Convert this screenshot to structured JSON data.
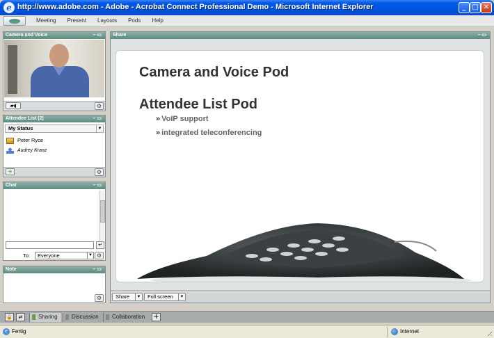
{
  "window": {
    "title": "http://www.adobe.com - Adobe - Acrobat Connect Professional Demo - Microsoft Internet Explorer",
    "minimize": "_",
    "maximize": "□",
    "close": "✕"
  },
  "menu": {
    "items": [
      "Meeting",
      "Present",
      "Layouts",
      "Pods",
      "Help"
    ]
  },
  "pods": {
    "camera": {
      "title": "Camera and Voice"
    },
    "attendee": {
      "title": "Attendee List (2)",
      "status_label": "My Status",
      "attendees": [
        "Peter Ryce",
        "Audrey Kranz"
      ]
    },
    "chat": {
      "title": "Chat",
      "to_label": "To:",
      "to_value": "Everyone"
    },
    "note": {
      "title": "Note"
    },
    "share": {
      "title": "Share",
      "share_button": "Share",
      "fullscreen_button": "Full screen"
    }
  },
  "slide": {
    "heading1": "Camera and Voice Pod",
    "heading2": "Attendee List Pod",
    "bullet_mark": "»",
    "bullets": [
      "VoIP support",
      "integrated teleconferencing"
    ]
  },
  "layout_tabs": {
    "tabs": [
      "Sharing",
      "Discussion",
      "Collaboration"
    ],
    "add": "+"
  },
  "statusbar": {
    "text": "Fertig",
    "zone": "Internet"
  },
  "colors": {
    "pod_header": "#5e8a80",
    "titlebar": "#0054e3",
    "slide_heading": "#333333"
  }
}
